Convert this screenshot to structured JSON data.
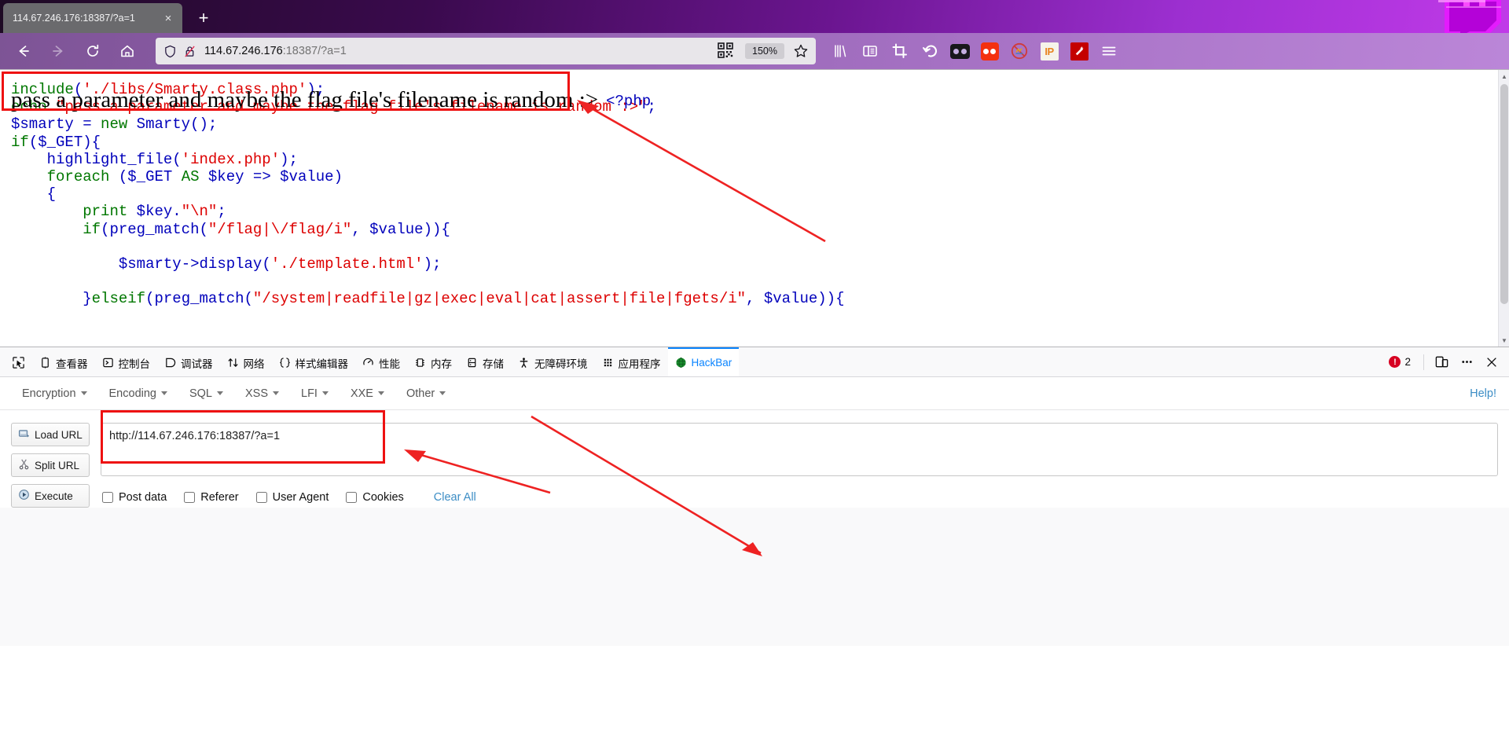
{
  "browser": {
    "tab": {
      "title": "114.67.246.176:18387/?a=1",
      "close_label": "×"
    },
    "new_tab_label": "+",
    "nav": {
      "back": "back-arrow",
      "forward": "forward-arrow",
      "reload": "reload-arrow",
      "home": "home-house"
    },
    "urlbar": {
      "host": "114.67.246.176",
      "rest": ":18387/?a=1",
      "shield_icon": "shield-icon",
      "lock_icon": "lock-crossed-icon",
      "qr_icon": "qr-code-icon",
      "zoom_level": "150%",
      "star_icon": "star-icon"
    },
    "extensions": [
      {
        "name": "library-icon",
        "label": "Library"
      },
      {
        "name": "sidebar-icon",
        "label": "Sidebars"
      },
      {
        "name": "screenshot-crop-icon",
        "label": "Screenshot"
      },
      {
        "name": "undo-arrow-icon",
        "label": "Undo Close Tab"
      },
      {
        "name": "dark-reader-icon",
        "label": "Dark Reader"
      },
      {
        "name": "rednote-icon",
        "label": "Extension"
      },
      {
        "name": "no-script-icon",
        "label": "NoScript"
      },
      {
        "name": "ip-lookup-icon",
        "label": "IP"
      },
      {
        "name": "magic-wand-icon",
        "label": "Wappalyzer"
      }
    ],
    "menu_icon": "hamburger-menu-icon"
  },
  "page": {
    "echo_line": "pass a parameter and maybe the flag file's filename is random :>",
    "php_open_tag": "<?php",
    "code_lines": [
      "include('./libs/Smarty.class.php');",
      "echo \"pass a parameter and maybe the flag file's filename is random :>\";",
      "$smarty = new Smarty();",
      "if($_GET){",
      "    highlight_file('index.php');",
      "    foreach ($_GET AS $key => $value)",
      "    {",
      "        print $key.\"\\n\";",
      "        if(preg_match(\"/flag|\\/flag/i\", $value)){",
      "",
      "            $smarty->display('./template.html');",
      "",
      "        }elseif(preg_match(\"/system|readfile|gz|exec|eval|cat|assert|file|fgets/i\", $value)){"
    ]
  },
  "devtools": {
    "tabs": [
      {
        "label": "",
        "icon": "picker-icon",
        "active": false
      },
      {
        "label": "查看器",
        "icon": "inspector-icon",
        "active": false
      },
      {
        "label": "控制台",
        "icon": "console-icon",
        "active": false
      },
      {
        "label": "调试器",
        "icon": "debugger-icon",
        "active": false
      },
      {
        "label": "网络",
        "icon": "network-icon",
        "active": false
      },
      {
        "label": "样式编辑器",
        "icon": "style-editor-icon",
        "active": false
      },
      {
        "label": "性能",
        "icon": "performance-icon",
        "active": false
      },
      {
        "label": "内存",
        "icon": "memory-icon",
        "active": false
      },
      {
        "label": "存储",
        "icon": "storage-icon",
        "active": false
      },
      {
        "label": "无障碍环境",
        "icon": "accessibility-icon",
        "active": false
      },
      {
        "label": "应用程序",
        "icon": "application-icon",
        "active": false
      },
      {
        "label": "HackBar",
        "icon": "hackbar-icon",
        "active": true
      }
    ],
    "error_count": "2",
    "error_badge_glyph": "!",
    "responsive_icon": "responsive-design-icon",
    "meatball_icon": "more-options-icon",
    "close_icon": "close-devtools-icon"
  },
  "hackbar": {
    "menu": [
      {
        "label": "Encryption"
      },
      {
        "label": "Encoding"
      },
      {
        "label": "SQL"
      },
      {
        "label": "XSS"
      },
      {
        "label": "LFI"
      },
      {
        "label": "XXE"
      },
      {
        "label": "Other"
      }
    ],
    "help_label": "Help!",
    "buttons": [
      {
        "label": "Load URL",
        "icon": "load-url-icon"
      },
      {
        "label": "Split URL",
        "icon": "split-url-icon"
      },
      {
        "label": "Execute",
        "icon": "execute-play-icon"
      }
    ],
    "url_value": "http://114.67.246.176:18387/?a=1",
    "url_placeholder": "",
    "checkboxes": [
      {
        "label": "Post data",
        "checked": false
      },
      {
        "label": "Referer",
        "checked": false
      },
      {
        "label": "User Agent",
        "checked": false
      },
      {
        "label": "Cookies",
        "checked": false
      }
    ],
    "clear_all_label": "Clear All"
  },
  "annotations": {
    "accent_red": "#ee1111",
    "highlight_boxes": 2,
    "arrows": 3
  }
}
